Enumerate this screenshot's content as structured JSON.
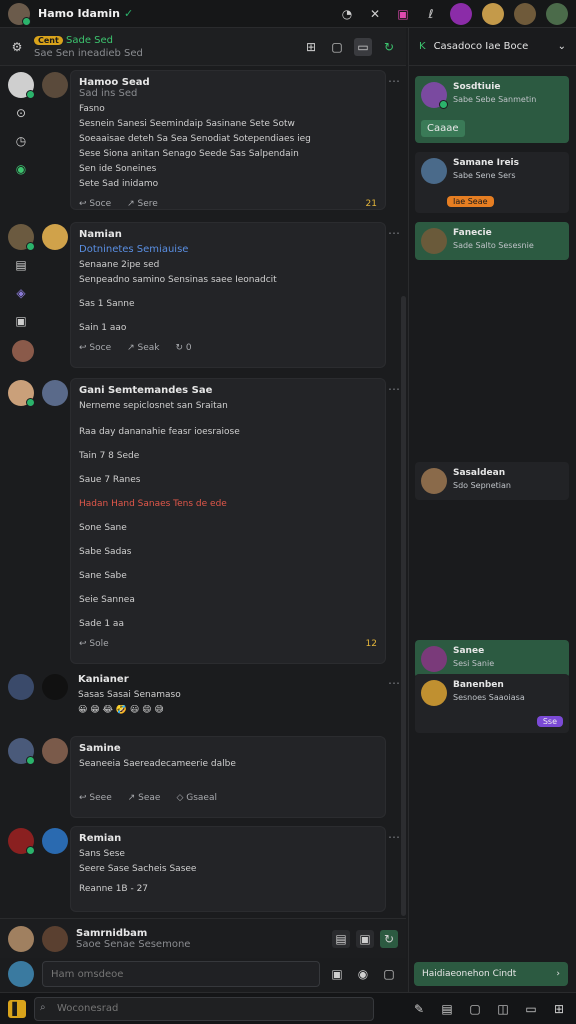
{
  "app": {
    "title": "Hamo Idamin"
  },
  "subbar": {
    "pill": "Cent",
    "status": "Sade Sed",
    "text": "Sae Sen ineadieb Sed"
  },
  "posts": [
    {
      "name": "Hamoo Sead",
      "sub": "Sad ins Sed",
      "lines": [
        "Fasno",
        "Sesnein Sanesi Seemindaip Sasinane Sete Sotw",
        "Soeaaisae deteh Sa Sea Senodiat Sotependiaes ieg",
        "Sese Siona anitan Senago Seede Sas Salpendain",
        "Sen ide Soneines",
        "Sete Sad inidamo"
      ],
      "actions": [
        "Soce",
        "Sere"
      ],
      "right_action": "21"
    },
    {
      "name": "Namian",
      "sub": "Dotninetes Semiauise",
      "lines": [
        "Senaane 2ipe sed",
        "Senpeadno samino Sensinas saee Ieonadcit",
        "Sas 1 Sanne",
        "Sain 1 aao"
      ],
      "actions": [
        "Soce",
        "Seak",
        "0"
      ]
    },
    {
      "name": "Gani Semtemandes Sae",
      "sub": "Nerneme sepiclosnet san Sraitan",
      "lines": [
        "Raa day dananahie feasr ioesraiose",
        "Tain 7 8 Sede",
        "Saue 7 Ranes",
        "Hadan Hand Sanaes Tens de ede",
        "Sone Sane",
        "Sabe Sadas",
        "Sane Sabe",
        "Seie Sannea",
        "Sade 1 aa"
      ],
      "actions": [
        "Sole",
        "12"
      ]
    },
    {
      "name": "Kanianer",
      "sub": "Sasas Sasai Senamaso",
      "lines": [],
      "actions": []
    },
    {
      "name": "Samine",
      "sub": "Seaneeia Saereadecameerie dalbe",
      "lines": [],
      "actions": [
        "Seee",
        "Seae",
        "Gsaeal"
      ]
    },
    {
      "name": "Remian",
      "sub": "Sans Sese",
      "lines": [
        "Seere Sase Sacheis Sasee",
        "Reanne 1B - 27"
      ],
      "actions": []
    },
    {
      "name": "Samrnidbam",
      "sub": "Saoe Senae Sesemone",
      "lines": [],
      "actions": []
    }
  ],
  "composer": {
    "placeholder": "Ham omsdeoe"
  },
  "bottom": {
    "search_placeholder": "Woconesrad"
  },
  "right": {
    "header": "Casadoco Iae Boce",
    "cards": [
      {
        "name": "Sosdtiuie",
        "sub": "Sabe Sebe Sanmetin",
        "button": "Caaae"
      },
      {
        "name": "Samane Ireis",
        "sub": "Sabe Sene Sers",
        "badge": "Iae Seae"
      },
      {
        "name": "Fanecie",
        "sub": "Sade Salto Sesesnie"
      },
      {
        "name": "Sasaldean",
        "sub": "Sdo Sepnetian"
      },
      {
        "name": "Sanee",
        "sub": "Sesi Sanie"
      },
      {
        "name": "Banenben",
        "sub": "Sesnoes Saaoiasa",
        "badge": "Sse"
      }
    ],
    "cta": "Haidiaeonehon Cindt"
  },
  "colors": {
    "accent_green": "#2c5a41",
    "online": "#2bb36b",
    "highlight": "#d9a31b"
  }
}
